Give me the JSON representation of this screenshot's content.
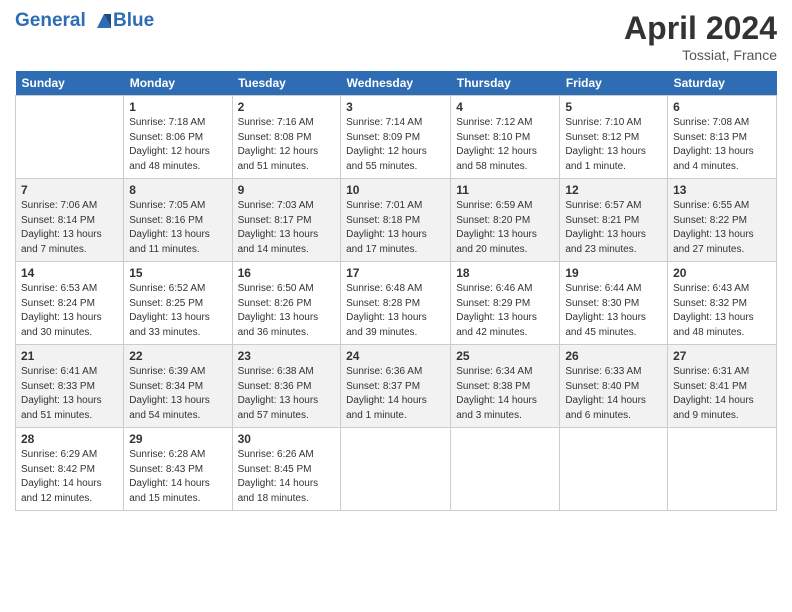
{
  "header": {
    "logo_line1": "General",
    "logo_line2": "Blue",
    "month_year": "April 2024",
    "location": "Tossiat, France"
  },
  "columns": [
    "Sunday",
    "Monday",
    "Tuesday",
    "Wednesday",
    "Thursday",
    "Friday",
    "Saturday"
  ],
  "weeks": [
    [
      {
        "day": "",
        "sunrise": "",
        "sunset": "",
        "daylight": ""
      },
      {
        "day": "1",
        "sunrise": "Sunrise: 7:18 AM",
        "sunset": "Sunset: 8:06 PM",
        "daylight": "Daylight: 12 hours and 48 minutes."
      },
      {
        "day": "2",
        "sunrise": "Sunrise: 7:16 AM",
        "sunset": "Sunset: 8:08 PM",
        "daylight": "Daylight: 12 hours and 51 minutes."
      },
      {
        "day": "3",
        "sunrise": "Sunrise: 7:14 AM",
        "sunset": "Sunset: 8:09 PM",
        "daylight": "Daylight: 12 hours and 55 minutes."
      },
      {
        "day": "4",
        "sunrise": "Sunrise: 7:12 AM",
        "sunset": "Sunset: 8:10 PM",
        "daylight": "Daylight: 12 hours and 58 minutes."
      },
      {
        "day": "5",
        "sunrise": "Sunrise: 7:10 AM",
        "sunset": "Sunset: 8:12 PM",
        "daylight": "Daylight: 13 hours and 1 minute."
      },
      {
        "day": "6",
        "sunrise": "Sunrise: 7:08 AM",
        "sunset": "Sunset: 8:13 PM",
        "daylight": "Daylight: 13 hours and 4 minutes."
      }
    ],
    [
      {
        "day": "7",
        "sunrise": "Sunrise: 7:06 AM",
        "sunset": "Sunset: 8:14 PM",
        "daylight": "Daylight: 13 hours and 7 minutes."
      },
      {
        "day": "8",
        "sunrise": "Sunrise: 7:05 AM",
        "sunset": "Sunset: 8:16 PM",
        "daylight": "Daylight: 13 hours and 11 minutes."
      },
      {
        "day": "9",
        "sunrise": "Sunrise: 7:03 AM",
        "sunset": "Sunset: 8:17 PM",
        "daylight": "Daylight: 13 hours and 14 minutes."
      },
      {
        "day": "10",
        "sunrise": "Sunrise: 7:01 AM",
        "sunset": "Sunset: 8:18 PM",
        "daylight": "Daylight: 13 hours and 17 minutes."
      },
      {
        "day": "11",
        "sunrise": "Sunrise: 6:59 AM",
        "sunset": "Sunset: 8:20 PM",
        "daylight": "Daylight: 13 hours and 20 minutes."
      },
      {
        "day": "12",
        "sunrise": "Sunrise: 6:57 AM",
        "sunset": "Sunset: 8:21 PM",
        "daylight": "Daylight: 13 hours and 23 minutes."
      },
      {
        "day": "13",
        "sunrise": "Sunrise: 6:55 AM",
        "sunset": "Sunset: 8:22 PM",
        "daylight": "Daylight: 13 hours and 27 minutes."
      }
    ],
    [
      {
        "day": "14",
        "sunrise": "Sunrise: 6:53 AM",
        "sunset": "Sunset: 8:24 PM",
        "daylight": "Daylight: 13 hours and 30 minutes."
      },
      {
        "day": "15",
        "sunrise": "Sunrise: 6:52 AM",
        "sunset": "Sunset: 8:25 PM",
        "daylight": "Daylight: 13 hours and 33 minutes."
      },
      {
        "day": "16",
        "sunrise": "Sunrise: 6:50 AM",
        "sunset": "Sunset: 8:26 PM",
        "daylight": "Daylight: 13 hours and 36 minutes."
      },
      {
        "day": "17",
        "sunrise": "Sunrise: 6:48 AM",
        "sunset": "Sunset: 8:28 PM",
        "daylight": "Daylight: 13 hours and 39 minutes."
      },
      {
        "day": "18",
        "sunrise": "Sunrise: 6:46 AM",
        "sunset": "Sunset: 8:29 PM",
        "daylight": "Daylight: 13 hours and 42 minutes."
      },
      {
        "day": "19",
        "sunrise": "Sunrise: 6:44 AM",
        "sunset": "Sunset: 8:30 PM",
        "daylight": "Daylight: 13 hours and 45 minutes."
      },
      {
        "day": "20",
        "sunrise": "Sunrise: 6:43 AM",
        "sunset": "Sunset: 8:32 PM",
        "daylight": "Daylight: 13 hours and 48 minutes."
      }
    ],
    [
      {
        "day": "21",
        "sunrise": "Sunrise: 6:41 AM",
        "sunset": "Sunset: 8:33 PM",
        "daylight": "Daylight: 13 hours and 51 minutes."
      },
      {
        "day": "22",
        "sunrise": "Sunrise: 6:39 AM",
        "sunset": "Sunset: 8:34 PM",
        "daylight": "Daylight: 13 hours and 54 minutes."
      },
      {
        "day": "23",
        "sunrise": "Sunrise: 6:38 AM",
        "sunset": "Sunset: 8:36 PM",
        "daylight": "Daylight: 13 hours and 57 minutes."
      },
      {
        "day": "24",
        "sunrise": "Sunrise: 6:36 AM",
        "sunset": "Sunset: 8:37 PM",
        "daylight": "Daylight: 14 hours and 1 minute."
      },
      {
        "day": "25",
        "sunrise": "Sunrise: 6:34 AM",
        "sunset": "Sunset: 8:38 PM",
        "daylight": "Daylight: 14 hours and 3 minutes."
      },
      {
        "day": "26",
        "sunrise": "Sunrise: 6:33 AM",
        "sunset": "Sunset: 8:40 PM",
        "daylight": "Daylight: 14 hours and 6 minutes."
      },
      {
        "day": "27",
        "sunrise": "Sunrise: 6:31 AM",
        "sunset": "Sunset: 8:41 PM",
        "daylight": "Daylight: 14 hours and 9 minutes."
      }
    ],
    [
      {
        "day": "28",
        "sunrise": "Sunrise: 6:29 AM",
        "sunset": "Sunset: 8:42 PM",
        "daylight": "Daylight: 14 hours and 12 minutes."
      },
      {
        "day": "29",
        "sunrise": "Sunrise: 6:28 AM",
        "sunset": "Sunset: 8:43 PM",
        "daylight": "Daylight: 14 hours and 15 minutes."
      },
      {
        "day": "30",
        "sunrise": "Sunrise: 6:26 AM",
        "sunset": "Sunset: 8:45 PM",
        "daylight": "Daylight: 14 hours and 18 minutes."
      },
      {
        "day": "",
        "sunrise": "",
        "sunset": "",
        "daylight": ""
      },
      {
        "day": "",
        "sunrise": "",
        "sunset": "",
        "daylight": ""
      },
      {
        "day": "",
        "sunrise": "",
        "sunset": "",
        "daylight": ""
      },
      {
        "day": "",
        "sunrise": "",
        "sunset": "",
        "daylight": ""
      }
    ]
  ]
}
